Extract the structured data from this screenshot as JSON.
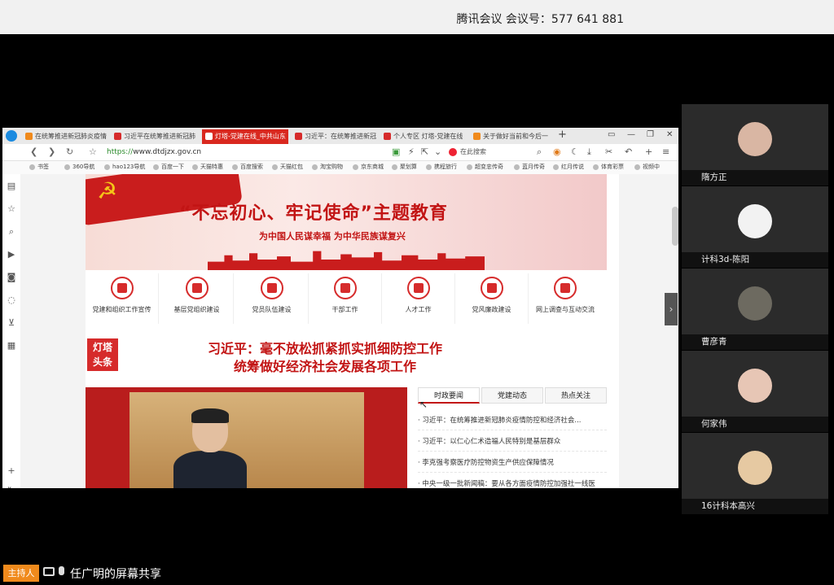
{
  "meeting": {
    "title": "腾讯会议 会议号：577 641 881"
  },
  "browser": {
    "tabs": [
      {
        "label": "在统筹推进新冠肺炎疫情",
        "active": false,
        "fav_color": "#f08a1c"
      },
      {
        "label": "习近平在统筹推进新冠肺",
        "active": false,
        "fav_color": "#d62b2b"
      },
      {
        "label": "灯塔-党建在线_中共山东",
        "active": true,
        "fav_color": "#ffffff"
      },
      {
        "label": "习近平：在统筹推进新冠",
        "active": false,
        "fav_color": "#d62b2b"
      },
      {
        "label": "个人专区 灯塔-党建在线",
        "active": false,
        "fav_color": "#d62b2b"
      },
      {
        "label": "关于做好当前和今后一",
        "active": false,
        "fav_color": "#f08a1c"
      }
    ],
    "url_protocol": "https://",
    "url_host": "www.dtdjzx.gov.cn",
    "search_placeholder": "在此搜索",
    "bookmarks": [
      "书签",
      "360导航",
      "hao123导航",
      "百度一下",
      "天猫特惠",
      "百度搜索",
      "天猫红包",
      "淘宝购物",
      "京东商城",
      "聚划算",
      "携程旅行",
      "超变忠传奇",
      "蓝月传奇",
      "红月传说",
      "体育彩票",
      "视频中"
    ]
  },
  "page": {
    "banner_title": "“不忘初心、牢记使命”主题教育",
    "banner_subtitle": "为中国人民谋幸福 为中华民族谋复兴",
    "nav_items": [
      "党建和组织工作宣传",
      "基层党组织建设",
      "党员队伍建设",
      "干部工作",
      "人才工作",
      "党风廉政建设",
      "网上调查与互动交流"
    ],
    "logo_text_1": "灯塔",
    "logo_text_2": "头条",
    "headline_line1": "习近平：毫不放松抓紧抓实抓细防控工作",
    "headline_line2": "统筹做好经济社会发展各项工作",
    "news_tabs": [
      "时政要闻",
      "党建动态",
      "热点关注"
    ],
    "news_items": [
      "· 习近平：在统筹推进新冠肺炎疫情防控和经济社会...",
      "· 习近平：以仁心仁术造福人民特别是基层群众",
      "· 李克强考察医疗防控物资生产供应保障情况",
      "· 中央一级一批新闻稿：要从各方面疫情防控加强社一线医"
    ]
  },
  "participants": [
    {
      "name": "隋方正",
      "avatar_color": "#d9b6a3"
    },
    {
      "name": "计科3d-陈阳",
      "avatar_color": "#f2f2f2"
    },
    {
      "name": "曹彦青",
      "avatar_color": "#6d6a60"
    },
    {
      "name": "何家伟",
      "avatar_color": "#e7c6b5"
    },
    {
      "name": "16计科本高兴",
      "avatar_color": "#e6c9a2"
    }
  ],
  "footer": {
    "host_badge": "主持人",
    "share_label": "任广明的屏幕共享"
  }
}
